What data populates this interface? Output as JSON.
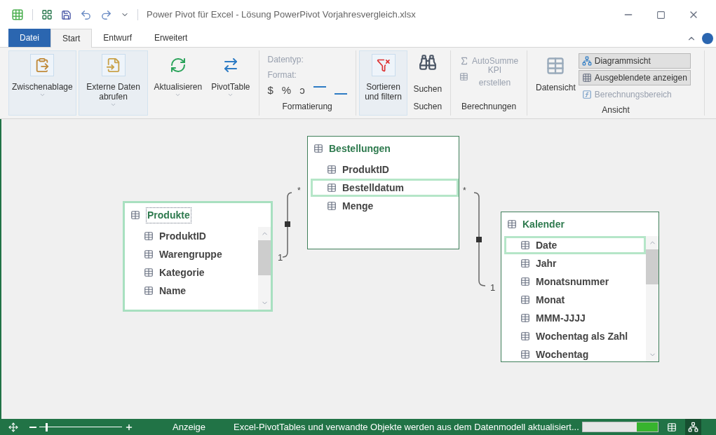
{
  "window": {
    "title": "Power Pivot für Excel - Lösung PowerPivot Vorjahresvergleich.xlsx"
  },
  "tabs": [
    {
      "label": "Datei",
      "kind": "file",
      "selected": false
    },
    {
      "label": "Start",
      "kind": "tab",
      "selected": true
    },
    {
      "label": "Entwurf",
      "kind": "tab",
      "selected": false
    },
    {
      "label": "Erweitert",
      "kind": "tab",
      "selected": false
    }
  ],
  "ribbon": {
    "large_buttons": [
      {
        "label": "Zwischenablage",
        "dropdown": true,
        "highlighted": true
      },
      {
        "label": "Externe Daten abrufen",
        "dropdown": true,
        "highlighted": true
      },
      {
        "label": "Aktualisieren",
        "dropdown": true,
        "highlighted": false
      },
      {
        "label": "PivotTable",
        "dropdown": true,
        "highlighted": false
      }
    ],
    "formatierung": {
      "label": "Formatierung",
      "datentyp": "Datentyp:",
      "format": "Format:",
      "symbols": [
        "$",
        "%",
        "ͻ"
      ]
    },
    "sortieren": {
      "label": "Sortieren und filtern"
    },
    "suchen": {
      "button": "Suchen",
      "label": "Suchen"
    },
    "berechnungen": {
      "label": "Berechnungen",
      "items": [
        {
          "label": "AutoSumme",
          "disabled": true
        },
        {
          "label": "KPI erstellen",
          "disabled": true
        }
      ]
    },
    "ansicht": {
      "label": "Ansicht",
      "datensicht": "Datensicht",
      "items": [
        {
          "label": "Diagrammsicht",
          "selected": true,
          "disabled": false
        },
        {
          "label": "Ausgeblendete anzeigen",
          "selected": true,
          "disabled": false
        },
        {
          "label": "Berechnungsbereich",
          "selected": false,
          "disabled": true
        }
      ]
    }
  },
  "tables": [
    {
      "name": "Produkte",
      "selected": true,
      "scrollbar": true,
      "fields": [
        {
          "name": "ProduktID",
          "selected": false
        },
        {
          "name": "Warengruppe",
          "selected": false
        },
        {
          "name": "Kategorie",
          "selected": false
        },
        {
          "name": "Name",
          "selected": false
        }
      ]
    },
    {
      "name": "Bestellungen",
      "selected": false,
      "scrollbar": false,
      "fields": [
        {
          "name": "ProduktID",
          "selected": false
        },
        {
          "name": "Bestelldatum",
          "selected": true
        },
        {
          "name": "Menge",
          "selected": false
        }
      ]
    },
    {
      "name": "Kalender",
      "selected": false,
      "scrollbar": true,
      "fields": [
        {
          "name": "Date",
          "selected": true
        },
        {
          "name": "Jahr",
          "selected": false
        },
        {
          "name": "Monatsnummer",
          "selected": false
        },
        {
          "name": "Monat",
          "selected": false
        },
        {
          "name": "MMM-JJJJ",
          "selected": false
        },
        {
          "name": "Wochentag als Zahl",
          "selected": false
        },
        {
          "name": "Wochentag",
          "selected": false
        }
      ]
    }
  ],
  "relationships": [
    {
      "many": "*",
      "one": "1"
    },
    {
      "many": "*",
      "one": "1"
    }
  ],
  "status_bar": {
    "zoom": {
      "level": 0.08
    },
    "label": "Anzeige",
    "message": "Excel-PivotTables und verwandte Objekte werden aus dem Datenmodell aktualisiert...",
    "progress": {
      "level": 0.28
    }
  }
}
